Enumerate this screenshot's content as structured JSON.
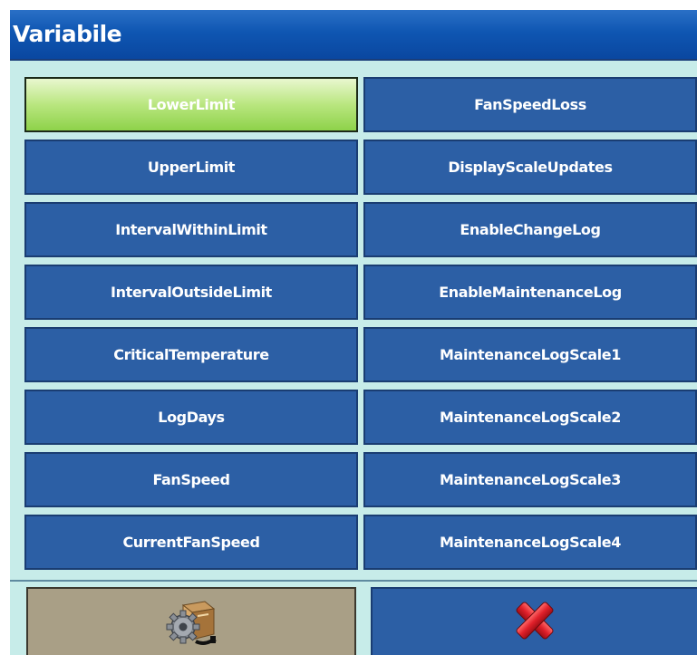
{
  "window": {
    "title": "Variabile"
  },
  "variables": {
    "left": [
      {
        "label": "LowerLimit",
        "selected": true
      },
      {
        "label": "UpperLimit",
        "selected": false
      },
      {
        "label": "IntervalWithinLimit",
        "selected": false
      },
      {
        "label": "IntervalOutsideLimit",
        "selected": false
      },
      {
        "label": "CriticalTemperature",
        "selected": false
      },
      {
        "label": "LogDays",
        "selected": false
      },
      {
        "label": "FanSpeed",
        "selected": false
      },
      {
        "label": "CurrentFanSpeed",
        "selected": false
      }
    ],
    "right": [
      {
        "label": "FanSpeedLoss",
        "selected": false
      },
      {
        "label": "DisplayScaleUpdates",
        "selected": false
      },
      {
        "label": "EnableChangeLog",
        "selected": false
      },
      {
        "label": "EnableMaintenanceLog",
        "selected": false
      },
      {
        "label": "MaintenanceLogScale1",
        "selected": false
      },
      {
        "label": "MaintenanceLogScale2",
        "selected": false
      },
      {
        "label": "MaintenanceLogScale3",
        "selected": false
      },
      {
        "label": "MaintenanceLogScale4",
        "selected": false
      }
    ]
  },
  "actions": {
    "setup_icon": "setup-gear-box-icon",
    "cancel_icon": "red-x-close-icon"
  },
  "colors": {
    "title_bar": "#0f56b2",
    "background": "#c7ece9",
    "button": "#2c5fa5",
    "selected_button": "#a8e06a",
    "setup_button": "#a99f86",
    "cancel_x": "#e0202a"
  }
}
